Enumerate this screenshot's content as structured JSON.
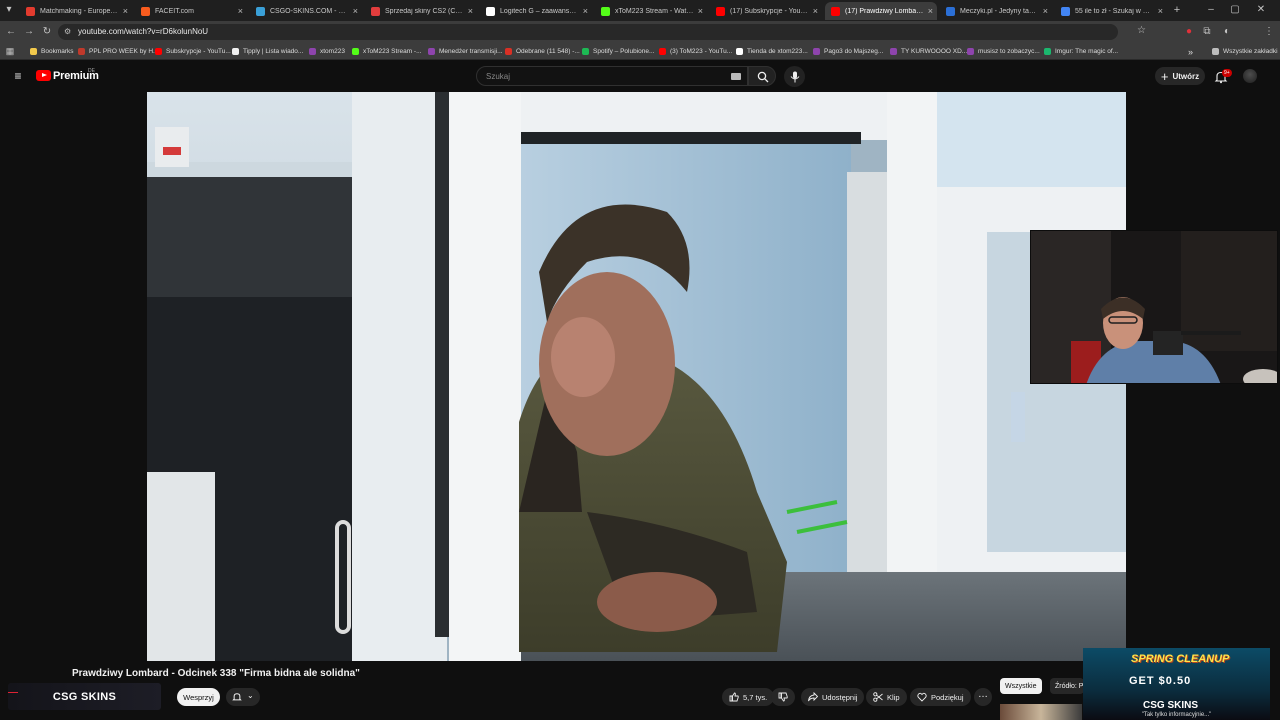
{
  "browser": {
    "tabs": [
      {
        "title": "Matchmaking - Europe 5v5 C",
        "favicon_color": "#e33b2e",
        "active": false
      },
      {
        "title": "FACEIT.com",
        "favicon_color": "#f95c1e",
        "active": false
      },
      {
        "title": "CSGO-SKINS.COM - Najlepsz",
        "favicon_color": "#3aa0d8",
        "active": false
      },
      {
        "title": "Sprzedaj skiny CS2 (CSGO) |",
        "favicon_color": "#e23d3d",
        "active": false
      },
      {
        "title": "Logitech G – zaawansowany",
        "favicon_color": "#ffffff",
        "active": false
      },
      {
        "title": "xToM223 Stream - Watch Live",
        "favicon_color": "#53fc18",
        "active": false
      },
      {
        "title": "(17) Subskrypcje - YouTube",
        "favicon_color": "#ff0000",
        "active": false
      },
      {
        "title": "(17) Prawdziwy Lombard - Od",
        "favicon_color": "#ff0000",
        "active": true
      },
      {
        "title": "Meczyki.pl - Jedyny taki porta",
        "favicon_color": "#2b6fd6",
        "active": false
      },
      {
        "title": "55 ile to zł - Szukaj w Google",
        "favicon_color": "#4285f4",
        "active": false
      }
    ],
    "url": "youtube.com/watch?v=rD6kolunNoU",
    "bookmarks": [
      {
        "label": "Bookmarks",
        "icon_color": "#f2c94c"
      },
      {
        "label": "PPL PRO WEEK by H...",
        "icon_color": "#c0392b"
      },
      {
        "label": "Subskrypcje - YouTu...",
        "icon_color": "#ff0000"
      },
      {
        "label": "Tipply | Lista wiado...",
        "icon_color": "#f1f1f1"
      },
      {
        "label": "xtom223",
        "icon_color": "#8e44ad"
      },
      {
        "label": "xToM223 Stream -...",
        "icon_color": "#53fc18"
      },
      {
        "label": "Menedżer transmisji...",
        "icon_color": "#8e44ad"
      },
      {
        "label": "Odebrane (11 548) -...",
        "icon_color": "#d93025"
      },
      {
        "label": "Spotify – Polubione...",
        "icon_color": "#1db954"
      },
      {
        "label": "(3) ToM223 - YouTu...",
        "icon_color": "#ff0000"
      },
      {
        "label": "Tienda de xtom223...",
        "icon_color": "#ffffff"
      },
      {
        "label": "Pago3 do Majszeg...",
        "icon_color": "#8e44ad"
      },
      {
        "label": "TY KURWOOOO XD...",
        "icon_color": "#8e44ad"
      },
      {
        "label": "musisz to zobaczyc...",
        "icon_color": "#8e44ad"
      },
      {
        "label": "Imgur: The magic of...",
        "icon_color": "#1bb76e"
      }
    ],
    "all_bookmarks_label": "Wszystkie zakładki"
  },
  "youtube": {
    "logo_label": "Premium",
    "region": "DE",
    "search_placeholder": "Szukaj",
    "create_label": "Utwórz",
    "notifications_badge": "9+",
    "video": {
      "title": "Prawdziwy Lombard - Odcinek 338 \"Firma bidna ale solidna\"",
      "support_label": "Wesprzyj",
      "likes": "5,7 tys.",
      "share_label": "Udostępnij",
      "clip_label": "Klip",
      "thanks_label": "Podziękuj"
    },
    "chips": [
      "Wszystkie",
      "Źródło: P"
    ]
  },
  "overlay": {
    "sponsor_banner": "CSG SKINS",
    "promo": {
      "headline": "SPRING CLEANUP",
      "offer": "GET $0.50",
      "brand": "CSG SKINS",
      "chat": "\"Tak tylko informacyjnie...\""
    }
  }
}
